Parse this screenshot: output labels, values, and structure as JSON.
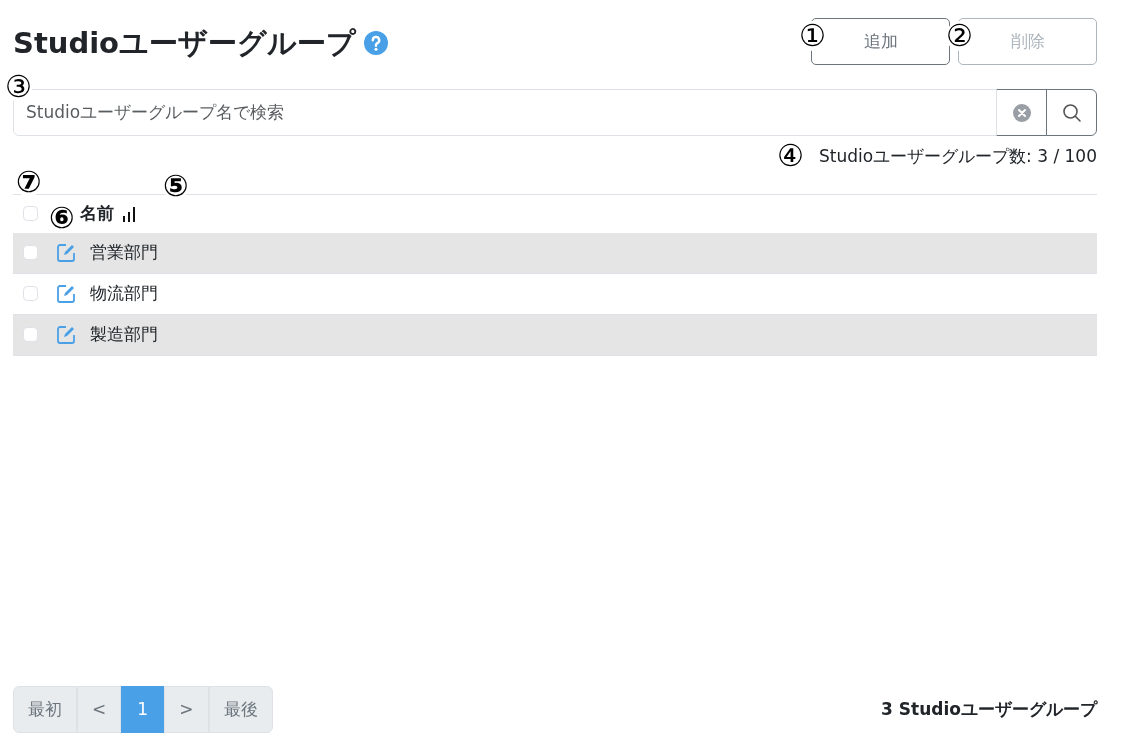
{
  "header": {
    "title": "Studioユーザーグループ"
  },
  "buttons": [
    {
      "label": "追加",
      "disabled": false,
      "callout": "①"
    },
    {
      "label": "削除",
      "disabled": true,
      "callout": "②"
    }
  ],
  "search": {
    "placeholder": "Studioユーザーグループ名で検索",
    "callout": "③"
  },
  "count": {
    "text": "Studioユーザーグループ数: 3 / 100",
    "callout": "④"
  },
  "table": {
    "select_all": {
      "checked": false,
      "callout": "⑦"
    },
    "columns": [
      {
        "label": "名前",
        "sort_callout": "⑤"
      }
    ],
    "edit_callout": "⑥",
    "rows": [
      {
        "name": "営業部門",
        "checked": false
      },
      {
        "name": "物流部門",
        "checked": false
      },
      {
        "name": "製造部門",
        "checked": false
      }
    ]
  },
  "pagination": {
    "items": [
      {
        "label": "最初",
        "selected": false
      },
      {
        "label": "<",
        "selected": false
      },
      {
        "label": "1",
        "selected": true
      },
      {
        "label": ">",
        "selected": false
      },
      {
        "label": "最後",
        "selected": false
      }
    ]
  },
  "footer": {
    "total": "3 Studioユーザーグループ"
  }
}
